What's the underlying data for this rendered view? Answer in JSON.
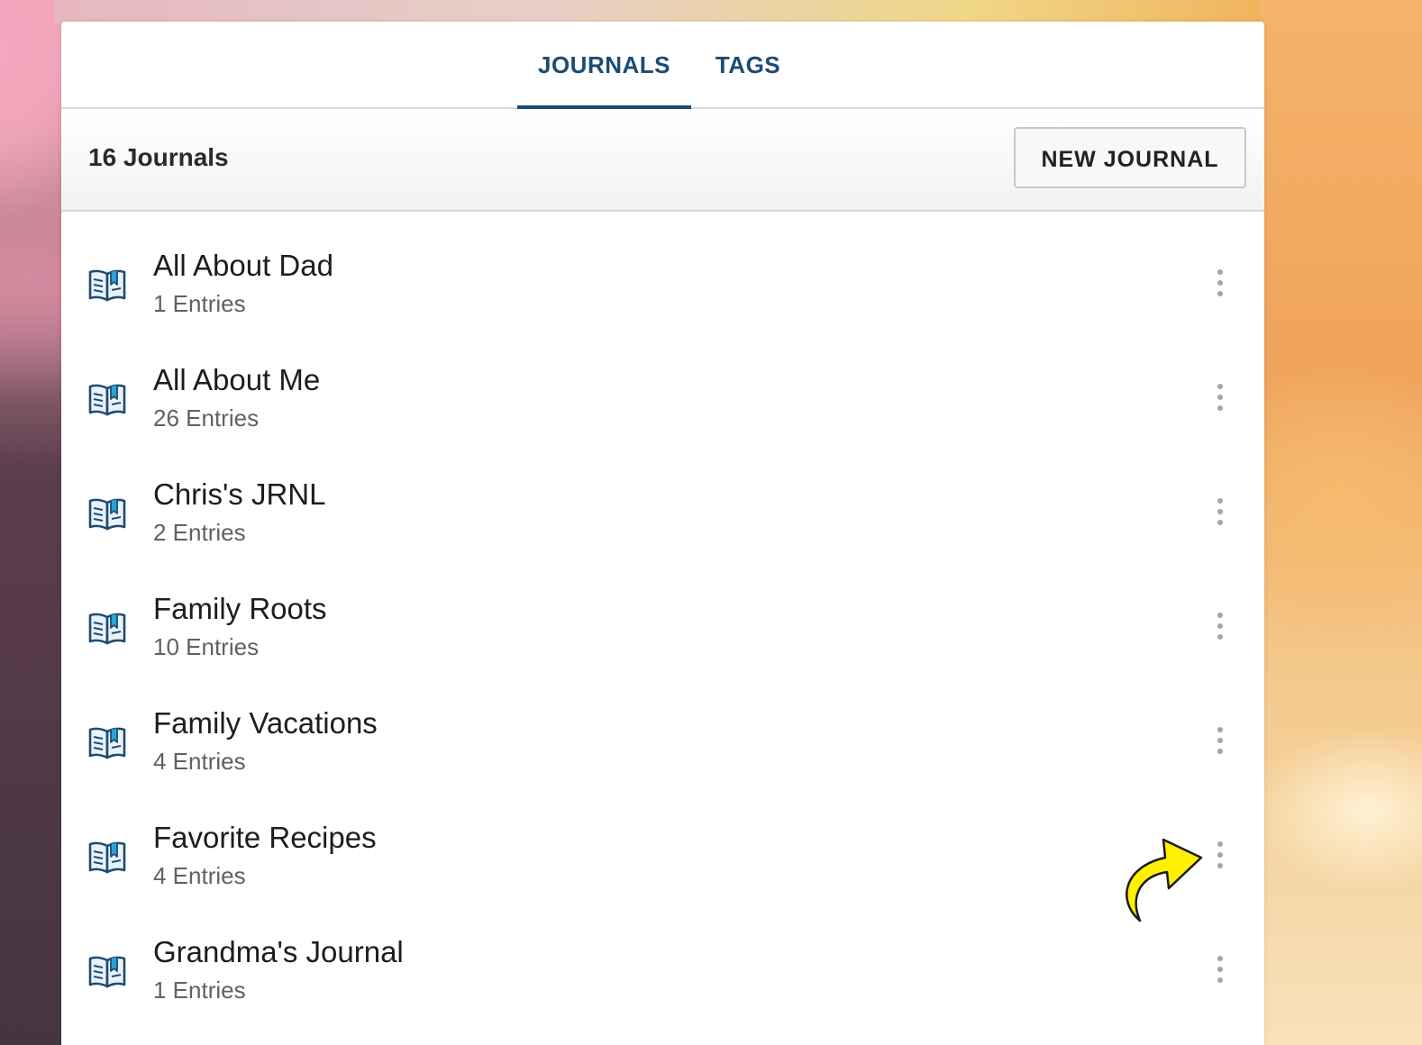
{
  "tabs": {
    "journals": "JOURNALS",
    "tags": "TAGS",
    "active": "journals"
  },
  "toolbar": {
    "count_label": "16 Journals",
    "new_button": "NEW JOURNAL"
  },
  "journals": [
    {
      "title": "All About Dad",
      "entries": "1 Entries"
    },
    {
      "title": "All About Me",
      "entries": "26 Entries"
    },
    {
      "title": "Chris's JRNL",
      "entries": "2 Entries"
    },
    {
      "title": "Family Roots",
      "entries": "10 Entries"
    },
    {
      "title": "Family Vacations",
      "entries": "4 Entries"
    },
    {
      "title": "Favorite Recipes",
      "entries": "4 Entries"
    },
    {
      "title": "Grandma's Journal",
      "entries": "1 Entries"
    }
  ],
  "colors": {
    "accent": "#1d4b73",
    "bookmark": "#2aa3d6",
    "annotation_arrow": "#ffef00"
  },
  "icons": {
    "journal": "open-book-icon",
    "row_menu": "kebab-menu-icon",
    "annotation": "curved-arrow-icon"
  }
}
